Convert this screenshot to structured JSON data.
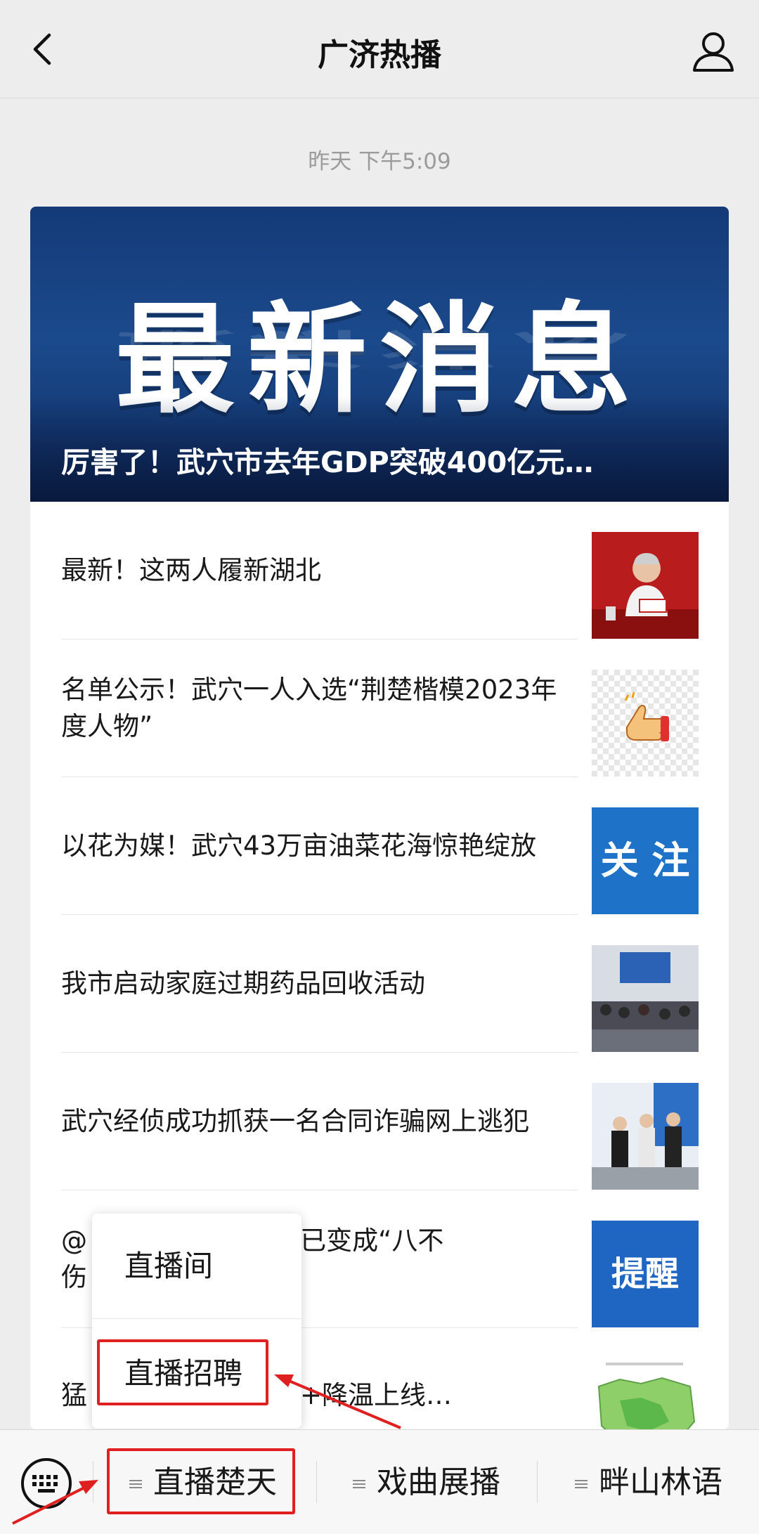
{
  "header": {
    "title": "广济热播",
    "back_icon": "chevron-left-icon",
    "profile_icon": "user-icon"
  },
  "timestamp": "昨天 下午5:09",
  "hero": {
    "image_text": "最新消息",
    "title": "厉害了！武穴市去年GDP突破400亿元…"
  },
  "articles": [
    {
      "title": "最新！这两人履新湖北"
    },
    {
      "title": "名单公示！武穴一人入选“荆楚楷模2023年度人物”"
    },
    {
      "title": "以花为媒！武穴43万亩油菜花海惊艳绽放",
      "thumb_text": "关 注"
    },
    {
      "title": "我市启动家庭过期药品回收活动"
    },
    {
      "title": "武穴经侦成功抓获一名合同诈骗网上逃犯"
    },
    {
      "title": "@",
      "title_right": "伤害”已变成“八不",
      "title_line2": "伤",
      "thumb_text": "提醒"
    },
    {
      "title": "猛",
      "title_right": "雨+降温上线…"
    }
  ],
  "popup_menu": {
    "items": [
      "直播间",
      "直播招聘"
    ]
  },
  "bottom_menu": {
    "keyboard_icon": "keyboard-icon",
    "tabs": [
      "直播楚天",
      "戏曲展播",
      "畔山林语"
    ]
  },
  "colors": {
    "annotation": "#e02020",
    "background": "#ededed",
    "hero_blue": "#143a78"
  }
}
